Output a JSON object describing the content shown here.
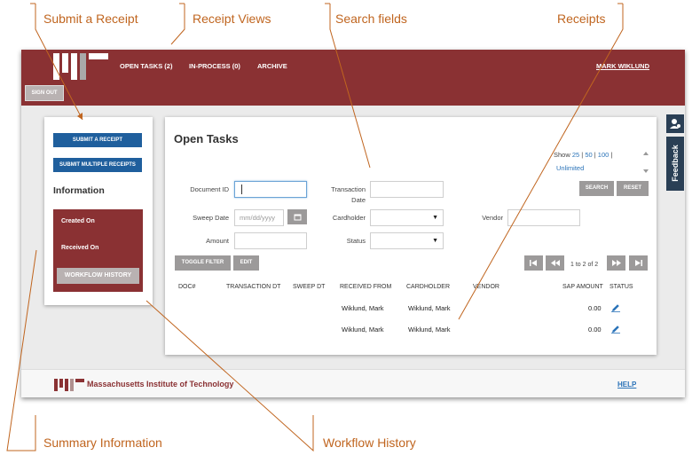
{
  "callouts": {
    "submit_receipt": "Submit a Receipt",
    "receipt_views": "Receipt Views",
    "search_fields": "Search fields",
    "receipts": "Receipts",
    "summary_information": "Summary Information",
    "workflow_history": "Workflow History"
  },
  "header": {
    "nav": [
      "OPEN TASKS (2)",
      "IN-PROCESS (0)",
      "ARCHIVE"
    ],
    "user": "MARK WIKLUND",
    "sign_out": "SIGN OUT"
  },
  "left_panel": {
    "submit_receipt": "SUBMIT A RECEIPT",
    "submit_multiple": "SUBMIT MULTIPLE RECEIPTS",
    "info_title": "Information",
    "created_on": "Created On",
    "received_on": "Received On",
    "workflow_history": "WORKFLOW HISTORY"
  },
  "main": {
    "title": "Open Tasks",
    "show": {
      "label": "Show",
      "opt1": "25",
      "opt2": "50",
      "opt3": "100",
      "opt4": "Unlimited"
    },
    "search": {
      "document_id": "Document ID",
      "transaction_date_1": "Transaction",
      "transaction_date_2": "Date",
      "sweep_date": "Sweep Date",
      "sweep_placeholder": "mm/dd/yyyy",
      "cardholder": "Cardholder",
      "vendor": "Vendor",
      "amount": "Amount",
      "status": "Status"
    },
    "buttons": {
      "search": "SEARCH",
      "reset": "RESET",
      "toggle_filter": "TOGGLE FILTER",
      "edit": "EDIT"
    },
    "pager": {
      "text": "1 to 2 of 2"
    },
    "columns": [
      "DOC#",
      "TRANSACTION DT",
      "SWEEP DT",
      "RECEIVED FROM",
      "CARDHOLDER",
      "VENDOR",
      "SAP AMOUNT",
      "STATUS"
    ],
    "rows": [
      {
        "received_from": "Wiklund, Mark",
        "cardholder": "Wiklund, Mark",
        "sap_amount": "0.00"
      },
      {
        "received_from": "Wiklund, Mark",
        "cardholder": "Wiklund, Mark",
        "sap_amount": "0.00"
      }
    ]
  },
  "footer": {
    "institution": "Massachusetts Institute of Technology",
    "help": "HELP"
  },
  "feedback": "Feedback",
  "colors": {
    "brand": "#8a3133",
    "button_blue": "#1f5f9d",
    "callout": "#c0651f",
    "link": "#2a73b8"
  },
  "icons": [
    "calendar-icon",
    "pencil-icon",
    "first-page-icon",
    "prev-page-icon",
    "next-page-icon",
    "last-page-icon",
    "user-icon"
  ]
}
